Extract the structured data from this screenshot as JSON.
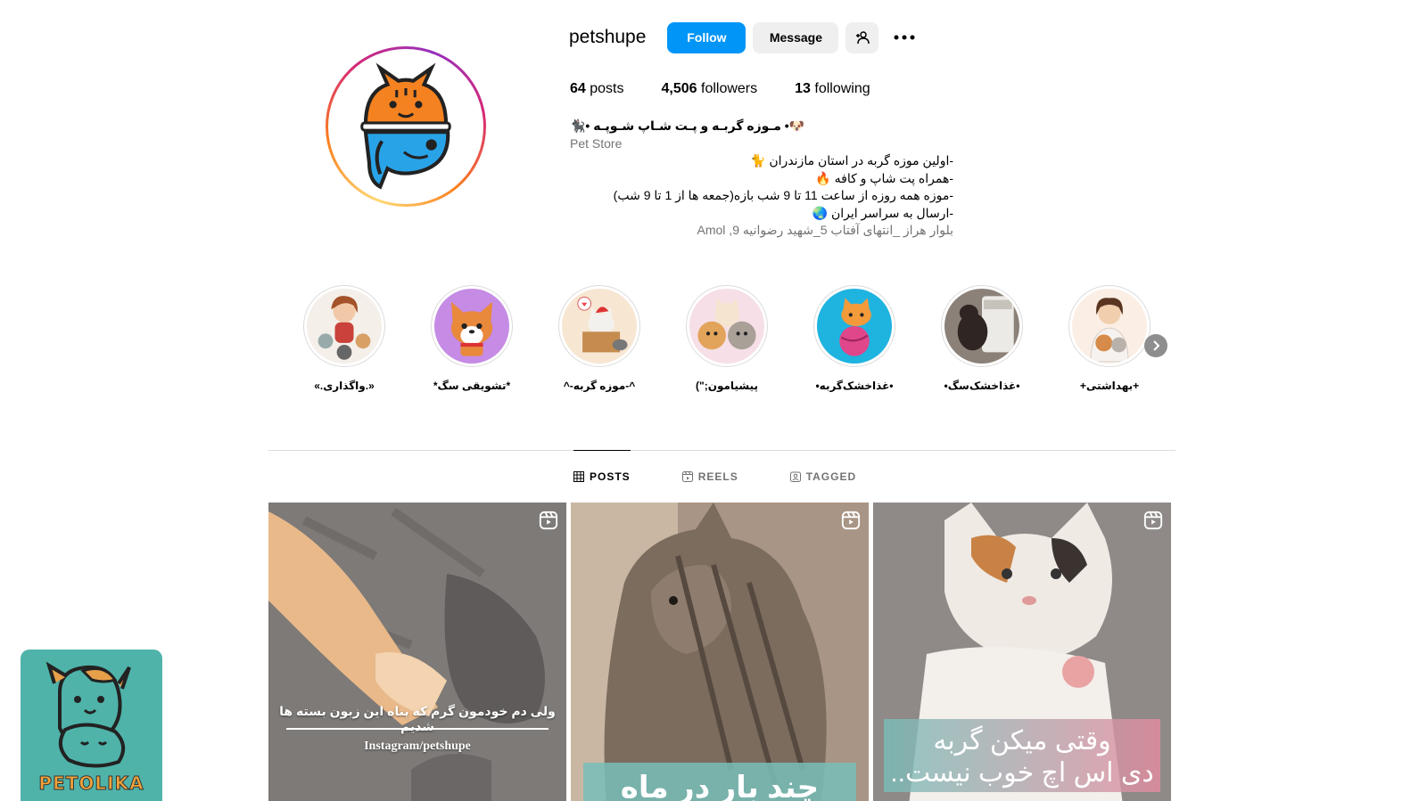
{
  "profile": {
    "username": "petshupe",
    "follow_label": "Follow",
    "message_label": "Message",
    "posts_count": "64",
    "posts_label": "posts",
    "followers_count": "4,506",
    "followers_label": "followers",
    "following_count": "13",
    "following_label": "following"
  },
  "bio": {
    "name": "🐶• مـوزه گربـه و پـت شـاپ شـوپـه •🐈‍⬛",
    "category": "Pet Store",
    "lines": [
      "-اولین موزه گربه در استان مازندران 🐈",
      "-همراه پت شاپ و کافه 🔥",
      "-موزه همه روزه از ساعت 11 تا 9 شب بازه(جمعه ها از 1 تا 9 شب)",
      "-ارسال به سراسر ایران 🌏"
    ],
    "location": "بلوار هراز _انتهای آفتاب 5_شهید رضوانیه 9, Amol"
  },
  "highlights": [
    {
      "label": "«.واگذاری.»",
      "icon": "girl-with-cats"
    },
    {
      "label": "*تشویقی سگ*",
      "icon": "corgi"
    },
    {
      "label": "^-موزه گربه-^",
      "icon": "cat-in-box"
    },
    {
      "label": "پیشیامون;\")",
      "icon": "cat-and-dog-faces"
    },
    {
      "label": "•غذاخشک‌گربه•",
      "icon": "cat-on-ball"
    },
    {
      "label": "•غذاخشک‌سگ•",
      "icon": "dog-food-bag"
    },
    {
      "label": "+بهداشتی+",
      "icon": "vet-with-pets"
    }
  ],
  "tabs": [
    {
      "label": "POSTS",
      "active": true
    },
    {
      "label": "REELS",
      "active": false
    },
    {
      "label": "TAGGED",
      "active": false
    }
  ],
  "posts": [
    {
      "caption": "ولی دم خودمون گرم که پناه این زبون بسته ها شدیم",
      "handle": "Instagram/petshupe",
      "type": "reel"
    },
    {
      "caption": "چند بار در ماه",
      "type": "reel"
    },
    {
      "caption_line1": "وقتی میکن گربه",
      "caption_line2": "دی اس اچ خوب نیست..",
      "type": "reel"
    }
  ],
  "watermark": {
    "text": "PETOLIKA"
  },
  "colors": {
    "accent": "#0095f6",
    "muted": "#737373",
    "teal": "#4fb3a9"
  }
}
